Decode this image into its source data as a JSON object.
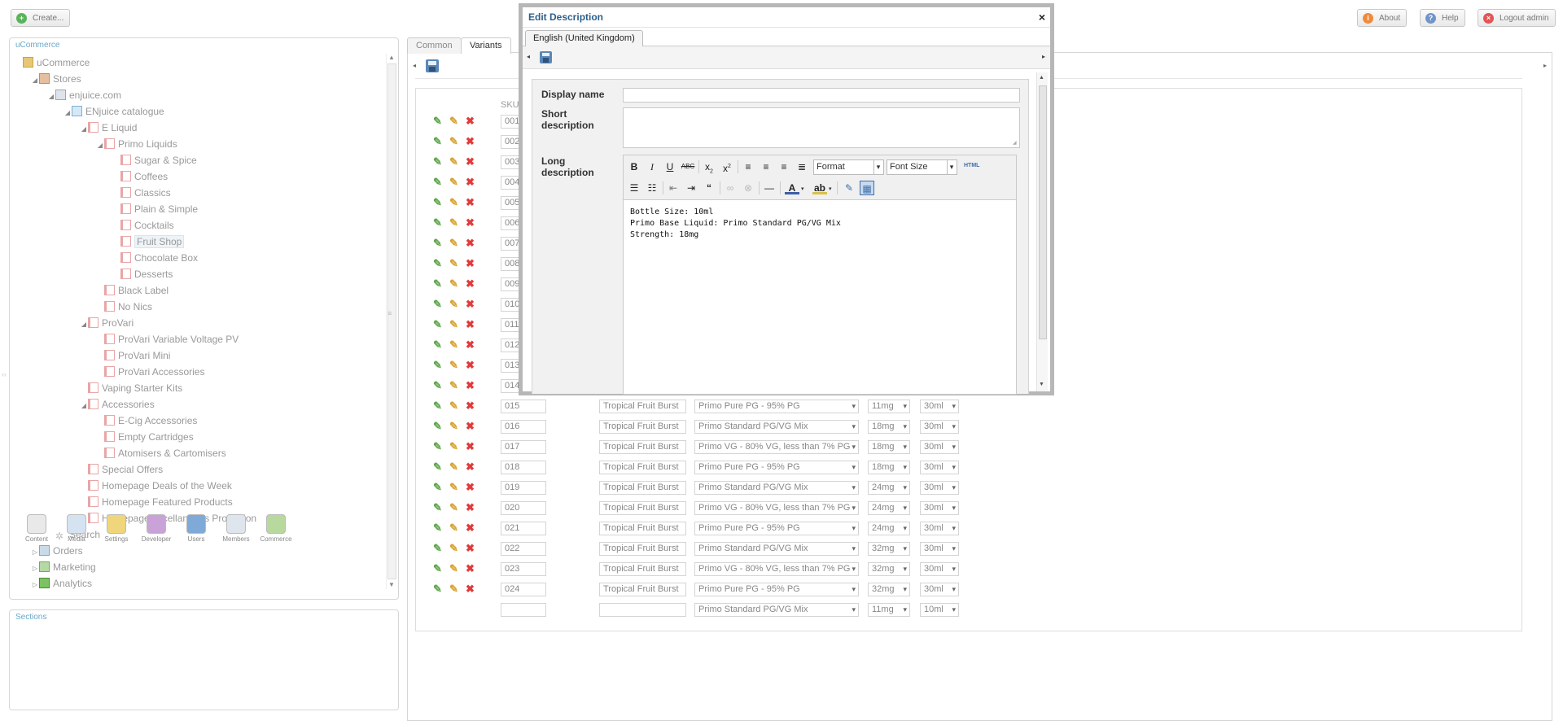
{
  "top": {
    "create": "Create...",
    "about": "About",
    "help": "Help",
    "logout": "Logout admin"
  },
  "tree": {
    "title": "uCommerce",
    "items": [
      {
        "label": "uCommerce",
        "icon": "folder"
      },
      {
        "label": "Stores",
        "icon": "store"
      },
      {
        "label": "enjuice.com",
        "icon": "cart"
      },
      {
        "label": "ENjuice catalogue",
        "icon": "cat"
      },
      {
        "label": "E Liquid",
        "icon": "doc"
      },
      {
        "label": "Primo Liquids",
        "icon": "doc"
      },
      {
        "label": "Sugar & Spice",
        "icon": "doc"
      },
      {
        "label": "Coffees",
        "icon": "doc"
      },
      {
        "label": "Classics",
        "icon": "doc"
      },
      {
        "label": "Plain & Simple",
        "icon": "doc"
      },
      {
        "label": "Cocktails",
        "icon": "doc"
      },
      {
        "label": "Fruit Shop",
        "icon": "doc"
      },
      {
        "label": "Chocolate Box",
        "icon": "doc"
      },
      {
        "label": "Desserts",
        "icon": "doc"
      },
      {
        "label": "Black Label",
        "icon": "doc"
      },
      {
        "label": "No Nics",
        "icon": "doc"
      },
      {
        "label": "ProVari",
        "icon": "doc"
      },
      {
        "label": "ProVari Variable Voltage PV",
        "icon": "doc"
      },
      {
        "label": "ProVari Mini",
        "icon": "doc"
      },
      {
        "label": "ProVari Accessories",
        "icon": "doc"
      },
      {
        "label": "Vaping Starter Kits",
        "icon": "doc"
      },
      {
        "label": "Accessories",
        "icon": "doc"
      },
      {
        "label": "E-Cig Accessories",
        "icon": "doc"
      },
      {
        "label": "Empty Cartridges",
        "icon": "doc"
      },
      {
        "label": "Atomisers & Cartomisers",
        "icon": "doc"
      },
      {
        "label": "Special Offers",
        "icon": "doc"
      },
      {
        "label": "Homepage Deals of the Week",
        "icon": "doc"
      },
      {
        "label": "Homepage Featured Products",
        "icon": "doc"
      },
      {
        "label": "Homepage Micellaneous Promotion",
        "icon": "doc"
      },
      {
        "label": "Search",
        "icon": "search"
      },
      {
        "label": "Orders",
        "icon": "orders"
      },
      {
        "label": "Marketing",
        "icon": "mark"
      },
      {
        "label": "Analytics",
        "icon": "anal"
      }
    ]
  },
  "sections": {
    "title": "Sections",
    "items": [
      "Content",
      "Media",
      "Settings",
      "Developer",
      "Users",
      "Members",
      "Commerce"
    ]
  },
  "tabs": {
    "common": "Common",
    "variants": "Variants"
  },
  "variants": {
    "sku_header": "SKU",
    "hidden_skus": [
      "001",
      "002",
      "003",
      "004",
      "005",
      "006",
      "007",
      "008",
      "009",
      "010",
      "011",
      "012",
      "013",
      "014"
    ],
    "rows": [
      {
        "sku": "015",
        "name": "Tropical Fruit Burst",
        "base": "Primo Pure PG - 95% PG",
        "strength": "11mg",
        "size": "30ml"
      },
      {
        "sku": "016",
        "name": "Tropical Fruit Burst",
        "base": "Primo Standard PG/VG Mix",
        "strength": "18mg",
        "size": "30ml"
      },
      {
        "sku": "017",
        "name": "Tropical Fruit Burst",
        "base": "Primo VG - 80% VG, less than 7% PG",
        "strength": "18mg",
        "size": "30ml"
      },
      {
        "sku": "018",
        "name": "Tropical Fruit Burst",
        "base": "Primo Pure PG - 95% PG",
        "strength": "18mg",
        "size": "30ml"
      },
      {
        "sku": "019",
        "name": "Tropical Fruit Burst",
        "base": "Primo Standard PG/VG Mix",
        "strength": "24mg",
        "size": "30ml"
      },
      {
        "sku": "020",
        "name": "Tropical Fruit Burst",
        "base": "Primo VG - 80% VG, less than 7% PG",
        "strength": "24mg",
        "size": "30ml"
      },
      {
        "sku": "021",
        "name": "Tropical Fruit Burst",
        "base": "Primo Pure PG - 95% PG",
        "strength": "24mg",
        "size": "30ml"
      },
      {
        "sku": "022",
        "name": "Tropical Fruit Burst",
        "base": "Primo Standard PG/VG Mix",
        "strength": "32mg",
        "size": "30ml"
      },
      {
        "sku": "023",
        "name": "Tropical Fruit Burst",
        "base": "Primo VG - 80% VG, less than 7% PG",
        "strength": "32mg",
        "size": "30ml"
      },
      {
        "sku": "024",
        "name": "Tropical Fruit Burst",
        "base": "Primo Pure PG - 95% PG",
        "strength": "32mg",
        "size": "30ml"
      }
    ],
    "new_row": {
      "sku": "",
      "name": "",
      "base": "Primo Standard PG/VG Mix",
      "strength": "11mg",
      "size": "10ml"
    }
  },
  "modal": {
    "title": "Edit Description",
    "language_tab": "English (United Kingdom)",
    "display_name_label": "Display name",
    "display_name_value": "",
    "short_desc_label": "Short description",
    "short_desc_value": "",
    "long_desc_label": "Long description",
    "format_label": "Format",
    "font_size_label": "Font Size",
    "html_label": "HTML",
    "content_lines": [
      "Bottle Size: 10ml",
      "Primo Base Liquid: Primo Standard PG/VG Mix",
      "Strength: 18mg"
    ]
  },
  "colors": {
    "accent": "#2b5f8a",
    "panel_title": "#6aa8c8",
    "delete": "#e23a3a",
    "edit": "#5fa64b"
  }
}
